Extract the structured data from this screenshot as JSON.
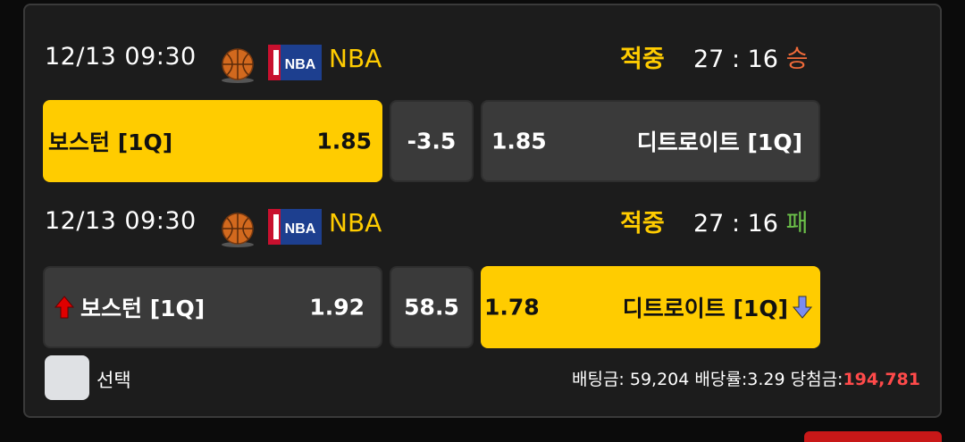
{
  "colors": {
    "accent": "#ffcc00",
    "win": "#f26b3a",
    "loss": "#6cc24a",
    "payout": "#ff4a4a"
  },
  "matches": [
    {
      "datetime": "12/13 09:30",
      "sport_icon": "basketball-icon",
      "league_icon": "nba-logo-icon",
      "league": "NBA",
      "result_label": "적중",
      "score": "27 : 16",
      "outcome": "승",
      "home": {
        "team": "보스턴 [1Q]",
        "odds": "1.85",
        "selected": true
      },
      "line": "-3.5",
      "away": {
        "team": "디트로이트 [1Q]",
        "odds": "1.85",
        "selected": false
      }
    },
    {
      "datetime": "12/13 09:30",
      "sport_icon": "basketball-icon",
      "league_icon": "nba-logo-icon",
      "league": "NBA",
      "result_label": "적중",
      "score": "27 : 16",
      "outcome": "패",
      "home": {
        "team": "보스턴 [1Q]",
        "odds": "1.92",
        "selected": false,
        "arrow": "up-arrow-icon"
      },
      "line": "58.5",
      "away": {
        "team": "디트로이트 [1Q]",
        "odds": "1.78",
        "selected": true,
        "arrow": "down-arrow-icon"
      }
    }
  ],
  "footer": {
    "select_label": "선택",
    "bet_amount_label": "배팅금:",
    "bet_amount": "59,204",
    "odds_label": "배당률:",
    "odds": "3.29",
    "payout_label": "당첨금:",
    "payout": "194,781"
  }
}
